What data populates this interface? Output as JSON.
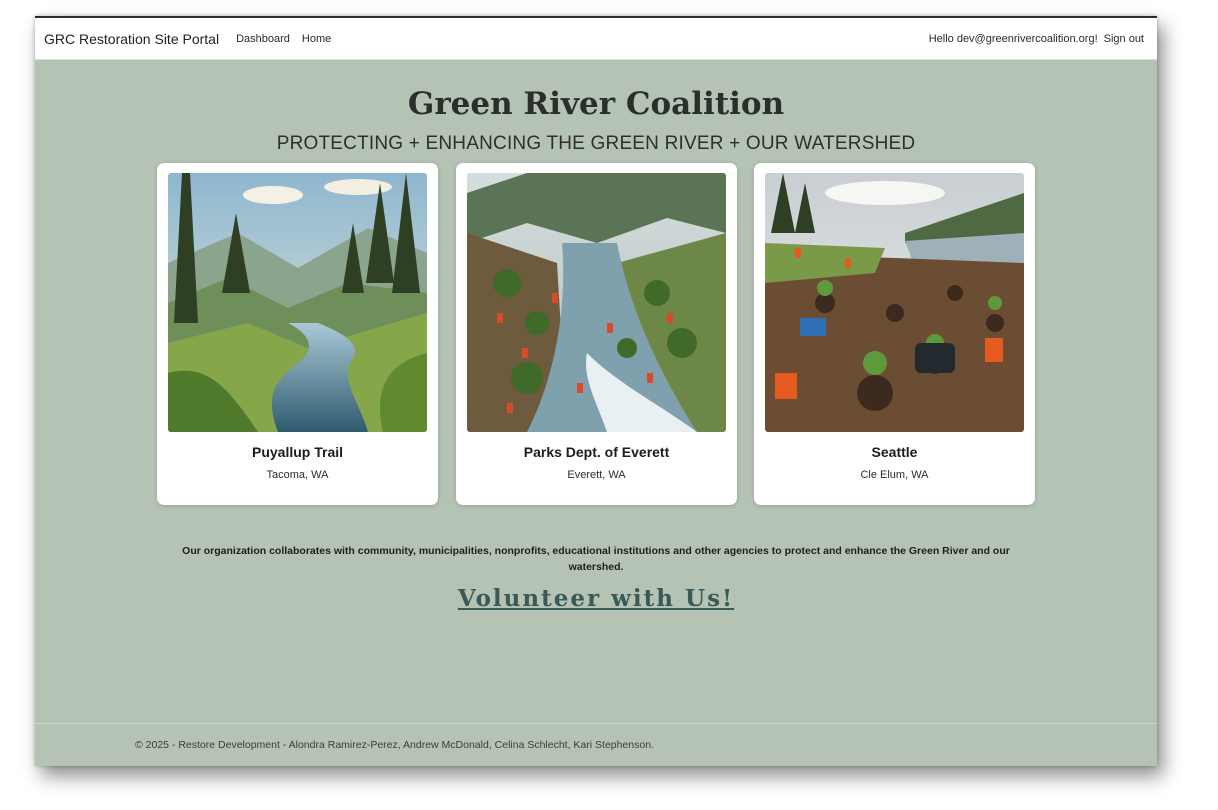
{
  "navbar": {
    "brand": "GRC Restoration Site Portal",
    "links": [
      "Dashboard",
      "Home"
    ],
    "greeting": "Hello dev@greenrivercoalition.org!",
    "signout": "Sign out"
  },
  "hero": {
    "title": "Green River Coalition",
    "subtitle": "PROTECTING + ENHANCING THE GREEN RIVER + OUR WATERSHED"
  },
  "sites": [
    {
      "name": "Puyallup Trail",
      "location": "Tacoma, WA"
    },
    {
      "name": "Parks Dept. of Everett",
      "location": "Everett, WA"
    },
    {
      "name": "Seattle",
      "location": "Cle Elum, WA"
    }
  ],
  "mission": "Our organization collaborates with community, municipalities, nonprofits, educational institutions and other agencies to protect and enhance the Green River and our watershed.",
  "cta": "Volunteer with Us!",
  "footer": "© 2025 - Restore Development - Alondra Ramirez-Perez, Andrew McDonald, Celina Schlecht, Kari Stephenson.",
  "colors": {
    "page_background": "#b5c3b5",
    "navbar": "#ffffff",
    "link_cta": "#3a5a58"
  }
}
